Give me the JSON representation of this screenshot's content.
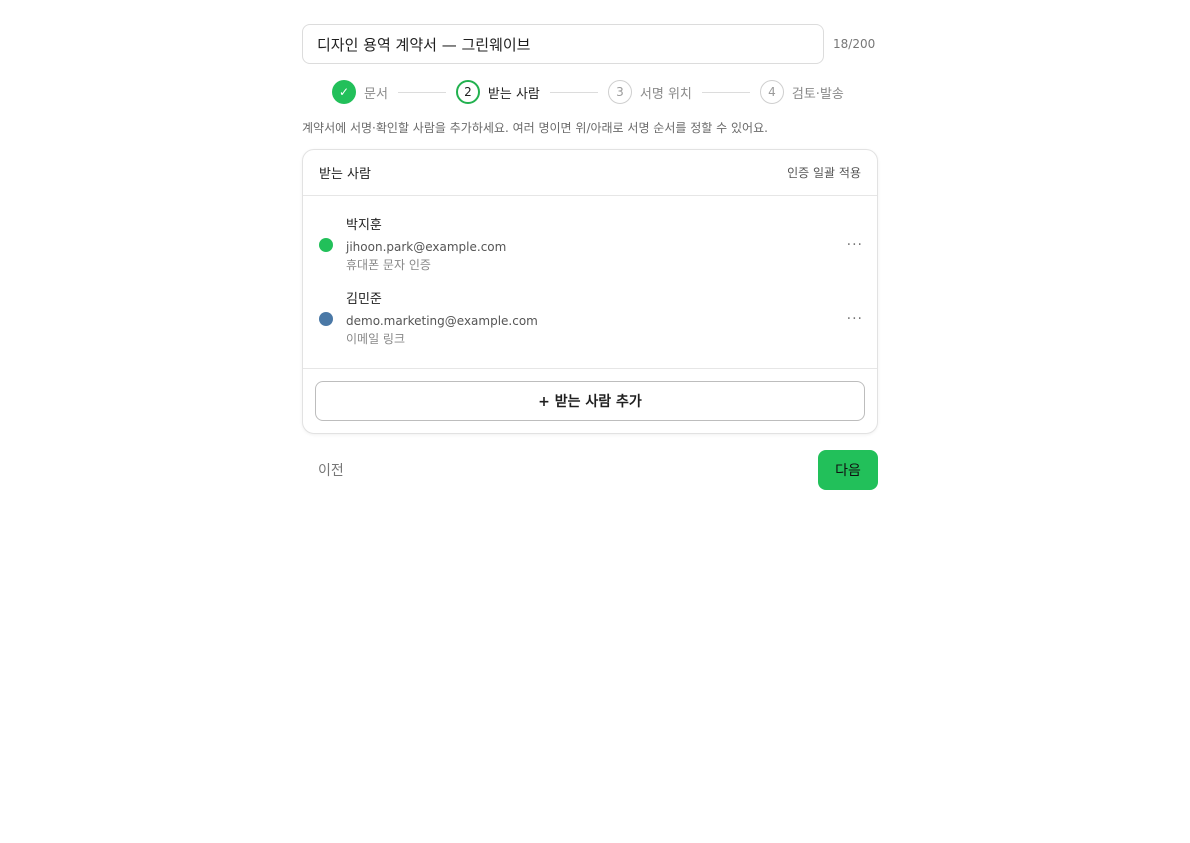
{
  "document": {
    "title_value": "디자인 용역 계약서 — 그린웨이브",
    "char_counter": "18/200"
  },
  "stepper": {
    "steps": [
      {
        "number": "",
        "label": "문서",
        "state": "done"
      },
      {
        "number": "2",
        "label": "받는 사람",
        "state": "active"
      },
      {
        "number": "3",
        "label": "서명 위치",
        "state": "pending"
      },
      {
        "number": "4",
        "label": "검토·발송",
        "state": "pending"
      }
    ],
    "done_glyph": "✓"
  },
  "help_text": "계약서에 서명·확인할 사람을 추가하세요. 여러 명이면 위/아래로 서명 순서를 정할 수 있어요.",
  "recipients_card": {
    "title": "받는 사람",
    "bulk_auth_label": "인증 일괄 적용",
    "recipients": [
      {
        "name": "박지훈",
        "email": "jihoon.park@example.com",
        "auth": "휴대폰 문자 인증",
        "color": "#22c05a"
      },
      {
        "name": "김민준",
        "email": "demo.marketing@example.com",
        "auth": "이메일 링크",
        "color": "#4a78a6"
      }
    ],
    "more_glyph": "···",
    "add_button_label": "+ 받는 사람 추가"
  },
  "footer": {
    "prev_label": "이전",
    "next_label": "다음"
  },
  "colors": {
    "accent": "#22c05a"
  }
}
